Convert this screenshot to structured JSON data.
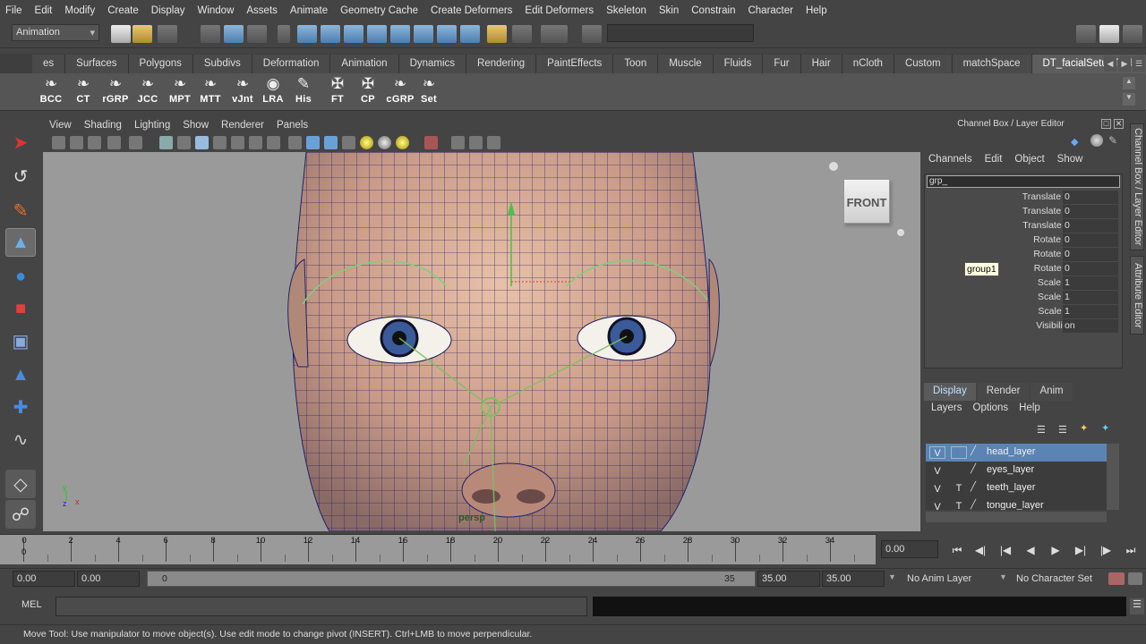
{
  "menubar": [
    "File",
    "Edit",
    "Modify",
    "Create",
    "Display",
    "Window",
    "Assets",
    "Animate",
    "Geometry Cache",
    "Create Deformers",
    "Edit Deformers",
    "Skeleton",
    "Skin",
    "Constrain",
    "Character",
    "Help"
  ],
  "status": {
    "mode": "Animation"
  },
  "shelf_tabs": [
    "es",
    "Surfaces",
    "Polygons",
    "Subdivs",
    "Deformation",
    "Animation",
    "Dynamics",
    "Rendering",
    "PaintEffects",
    "Toon",
    "Muscle",
    "Fluids",
    "Fur",
    "Hair",
    "nCloth",
    "Custom",
    "matchSpace",
    "DT_facialSetupTools"
  ],
  "shelf_active": "DT_facialSetupTools",
  "shelf_icons": [
    "BCC",
    "CT",
    "rGRP",
    "JCC",
    "MPT",
    "MTT",
    "vJnt",
    "LRA",
    "His",
    "FT",
    "CP",
    "cGRP",
    "Set"
  ],
  "panel_menu": [
    "View",
    "Shading",
    "Lighting",
    "Show",
    "Renderer",
    "Panels"
  ],
  "viewport": {
    "cube_label": "FRONT",
    "camera_label": "persp"
  },
  "channel_box": {
    "title": "Channel Box / Layer Editor",
    "menu": [
      "Channels",
      "Edit",
      "Object",
      "Show"
    ],
    "object_name": "grp_",
    "tooltip": "group1",
    "attributes": [
      {
        "name": "Translate X",
        "value": "0"
      },
      {
        "name": "Translate Y",
        "value": "0"
      },
      {
        "name": "Translate Z",
        "value": "0"
      },
      {
        "name": "Rotate X",
        "value": "0"
      },
      {
        "name": "Rotate Y",
        "value": "0"
      },
      {
        "name": "Rotate Z",
        "value": "0"
      },
      {
        "name": "Scale X",
        "value": "1"
      },
      {
        "name": "Scale Y",
        "value": "1"
      },
      {
        "name": "Scale Z",
        "value": "1"
      },
      {
        "name": "Visibility",
        "value": "on"
      }
    ]
  },
  "side_tabs": [
    "Channel Box / Layer Editor",
    "Attribute Editor"
  ],
  "layer_editor": {
    "tabs": [
      "Display",
      "Render",
      "Anim"
    ],
    "menu": [
      "Layers",
      "Options",
      "Help"
    ],
    "layers": [
      {
        "v": "V",
        "t": "",
        "name": "head_layer",
        "selected": true
      },
      {
        "v": "V",
        "t": "",
        "name": "eyes_layer",
        "selected": false
      },
      {
        "v": "V",
        "t": "T",
        "name": "teeth_layer",
        "selected": false
      },
      {
        "v": "V",
        "t": "T",
        "name": "tongue_layer",
        "selected": false
      }
    ]
  },
  "timeline": {
    "labels": [
      "0",
      "2",
      "4",
      "6",
      "8",
      "10",
      "12",
      "14",
      "16",
      "18",
      "20",
      "22",
      "24",
      "26",
      "28",
      "30",
      "32",
      "34"
    ],
    "start_marker": "0",
    "current_frame": "0.00"
  },
  "range": {
    "start_time": "0.00",
    "start_range": "0.00",
    "slider_start": "0",
    "slider_end": "35",
    "end_range": "35.00",
    "end_time": "35.00",
    "anim_layer": "No Anim Layer",
    "character_set": "No Character Set"
  },
  "mel": {
    "label": "MEL"
  },
  "help_line": "Move Tool: Use manipulator to move object(s). Use edit mode to change pivot (INSERT).  Ctrl+LMB to move perpendicular."
}
